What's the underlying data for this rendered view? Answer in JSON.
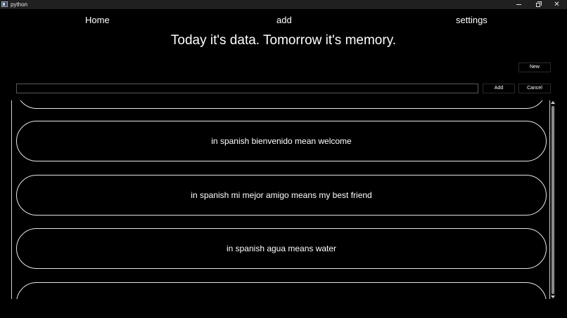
{
  "window": {
    "title": "python",
    "minimize_glyph": "",
    "close_glyph": "✕"
  },
  "nav": {
    "home": "Home",
    "add": "add",
    "settings": "settings"
  },
  "tagline": "Today it's data. Tomorrow it's memory.",
  "toolbar": {
    "new_label": "New",
    "add_label": "Add",
    "cancel_label": "Cancel"
  },
  "entry": {
    "value": "",
    "placeholder": ""
  },
  "cards": [
    {
      "text": ""
    },
    {
      "text": "in spanish bienvenido mean welcome"
    },
    {
      "text": "in spanish mi mejor amigo means my best friend"
    },
    {
      "text": "in spanish agua means water"
    },
    {
      "text": ""
    }
  ],
  "icons": {
    "app": "python-app-icon",
    "minimize": "minimize-icon",
    "maximize": "maximize-icon",
    "close": "close-icon"
  },
  "colors": {
    "background": "#000000",
    "titlebar": "#202020",
    "text": "#ffffff",
    "card_border": "#e6e6e6"
  }
}
